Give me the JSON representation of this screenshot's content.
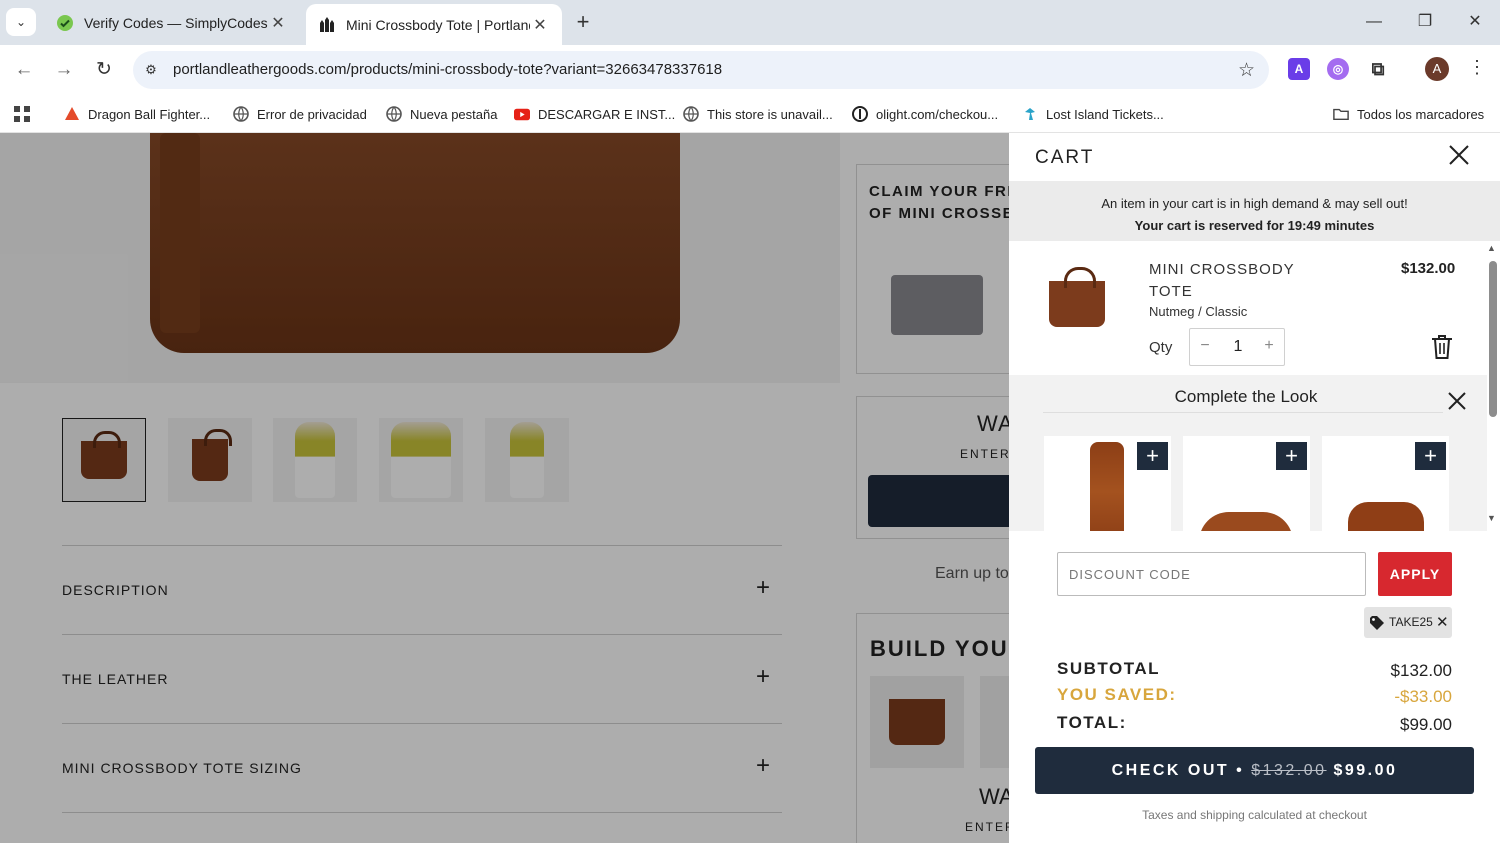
{
  "tabs": [
    {
      "title": "Verify Codes — SimplyCodes",
      "favicon": "simplycodes-icon",
      "active": false
    },
    {
      "title": "Mini Crossbody Tote | Portland Leather",
      "favicon": "portland-leather-icon",
      "active": true
    }
  ],
  "toolbar": {
    "url": "portlandleathergoods.com/products/mini-crossbody-tote?variant=32663478337618",
    "avatar_initial": "A",
    "extension_letter": "A"
  },
  "bookmarks": [
    {
      "label": "Dragon Ball Fighter...",
      "icon": "dragon-ball-icon"
    },
    {
      "label": "Error de privacidad",
      "icon": "globe-icon"
    },
    {
      "label": "Nueva pestaña",
      "icon": "globe-icon"
    },
    {
      "label": "DESCARGAR E INST...",
      "icon": "youtube-icon"
    },
    {
      "label": "This store is unavail...",
      "icon": "globe-icon"
    },
    {
      "label": "olight.com/checkou...",
      "icon": "olight-icon"
    },
    {
      "label": "Lost Island Tickets...",
      "icon": "lost-island-icon"
    }
  ],
  "all_bookmarks": "Todos los marcadores",
  "product_page": {
    "accordions": [
      "DESCRIPTION",
      "THE LEATHER",
      "MINI CROSSBODY TOTE SIZING"
    ],
    "claim_text": "CLAIM YOUR FRE\nOF MINI CROSSBO",
    "claim_line1": "CLAIM YOUR FRE",
    "claim_line2": "OF MINI CROSSBO",
    "wa_text": "WA",
    "enter_text": "ENTER",
    "earn_text": "Earn up to",
    "build_title": "BUILD YOUR",
    "wa2_text": "WA",
    "enter2_text": "ENTER"
  },
  "cart": {
    "title": "CART",
    "notice_line1": "An item in your cart is in high demand & may sell out!",
    "notice_line2": "Your cart is reserved for 19:49 minutes",
    "item": {
      "name": "MINI CROSSBODY TOTE",
      "variant": "Nutmeg / Classic",
      "price": "$132.00",
      "qty_label": "Qty",
      "qty": "1",
      "qty_minus": "−",
      "qty_plus": "+"
    },
    "complete_the_look": "Complete the Look",
    "discount_placeholder": "DISCOUNT CODE",
    "apply_label": "APPLY",
    "applied_code": "TAKE25",
    "subtotal_label": "SUBTOTAL",
    "subtotal_value": "$132.00",
    "saved_label": "YOU SAVED:",
    "saved_value": "-$33.00",
    "total_label": "TOTAL:",
    "total_value": "$99.00",
    "checkout_prefix": "CHECK OUT • ",
    "checkout_original": "$132.00",
    "checkout_final": " $99.00",
    "taxes_note": "Taxes and shipping calculated at checkout"
  },
  "colors": {
    "navy": "#1f2c3d",
    "apply_red": "#d7282f",
    "saved_gold": "#d8a63d"
  }
}
